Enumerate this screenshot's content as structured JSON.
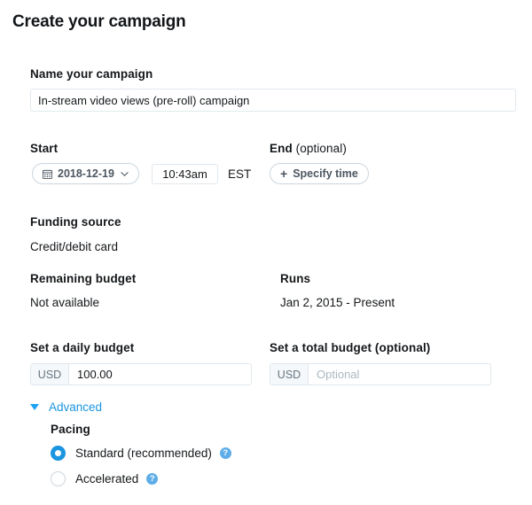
{
  "page": {
    "title": "Create your campaign"
  },
  "name_field": {
    "label": "Name your campaign",
    "value": "In-stream video views (pre-roll) campaign",
    "placeholder": ""
  },
  "schedule": {
    "start_label": "Start",
    "end_label_bold": "End",
    "end_label_optional": "(optional)",
    "date_value": "2018-12-19",
    "date_icon": "calendar-icon",
    "chevron_icon": "chevron-down-icon",
    "time_value": "10:43am",
    "time_placeholder": "",
    "timezone": "EST",
    "specify_time_label": "Specify time",
    "plus_icon": "plus-icon"
  },
  "funding": {
    "label": "Funding source",
    "value": "Credit/debit card"
  },
  "remaining": {
    "label": "Remaining budget",
    "value": "Not available"
  },
  "runs": {
    "label": "Runs",
    "value": "Jan 2, 2015 - Present"
  },
  "daily_budget": {
    "label": "Set a daily budget",
    "currency": "USD",
    "value": "100.00",
    "placeholder": ""
  },
  "total_budget": {
    "label": "Set a total budget (optional)",
    "currency": "USD",
    "value": "",
    "placeholder": "Optional"
  },
  "advanced": {
    "toggle_label": "Advanced",
    "toggle_icon": "triangle-down-icon",
    "pacing_label": "Pacing",
    "options": [
      {
        "label": "Standard (recommended)",
        "selected": true,
        "help_icon": "help-circle-icon",
        "help_glyph": "?"
      },
      {
        "label": "Accelerated",
        "selected": false,
        "help_icon": "help-circle-icon",
        "help_glyph": "?"
      }
    ]
  },
  "colors": {
    "accent_blue": "#1b95e0",
    "triangle_blue": "#1da1f2",
    "help_blue": "#5dade8",
    "text": "#14171a",
    "muted": "#66757f",
    "border": "#e1e8ed",
    "pill_border": "#ccd6dd",
    "prefix_bg": "#f5f8fa",
    "placeholder": "#aab8c2"
  }
}
